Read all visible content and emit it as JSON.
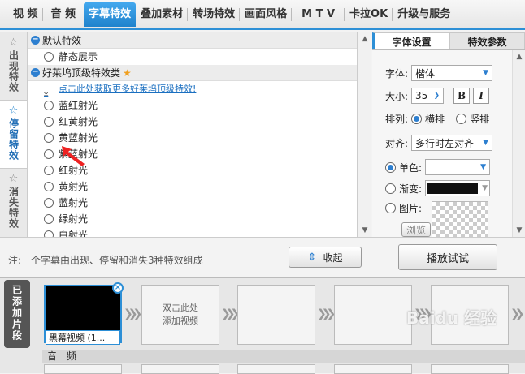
{
  "top_tabs": [
    {
      "label": "视 频"
    },
    {
      "label": "音 频"
    },
    {
      "label": "字幕特效"
    },
    {
      "label": "叠加素材"
    },
    {
      "label": "转场特效"
    },
    {
      "label": "画面风格"
    },
    {
      "label": "M T V"
    },
    {
      "label": "卡拉OK"
    },
    {
      "label": "升级与服务"
    }
  ],
  "side_tabs": [
    {
      "label": "出现特效"
    },
    {
      "label": "停留特效"
    },
    {
      "label": "消失特效"
    }
  ],
  "effects": {
    "group1": "默认特效",
    "group1_items": [
      "静态展示"
    ],
    "group2": "好莱坞顶级特效类",
    "promo_link": "点击此处获取更多好莱坞顶级特效!",
    "group2_items": [
      "蓝红射光",
      "红黄射光",
      "黄蓝射光",
      "紫蓝射光",
      "红射光",
      "黄射光",
      "蓝射光",
      "绿射光",
      "白射光"
    ]
  },
  "right_panel": {
    "tab_font": "字体设置",
    "tab_effect": "特效参数",
    "font_label": "字体:",
    "font_value": "楷体",
    "size_label": "大小:",
    "size_value": "35",
    "bold": "B",
    "italic": "I",
    "arrange_label": "排列:",
    "arrange_h": "横排",
    "arrange_v": "竖排",
    "align_label": "对齐:",
    "align_value": "多行时左对齐",
    "single_color": "单色:",
    "gradient": "渐变:",
    "image": "图片:",
    "browse": "浏览"
  },
  "note": {
    "text": "注:一个字幕由出现、停留和消失3种特效组成",
    "collapse": "收起",
    "play": "播放试试"
  },
  "timeline": {
    "added_label": "已添加片段",
    "clip_name": "黑幕视频 (1...",
    "add_video": "双击此处添加视频",
    "audio_label": "音 频"
  },
  "watermark": "Baidu 经验"
}
